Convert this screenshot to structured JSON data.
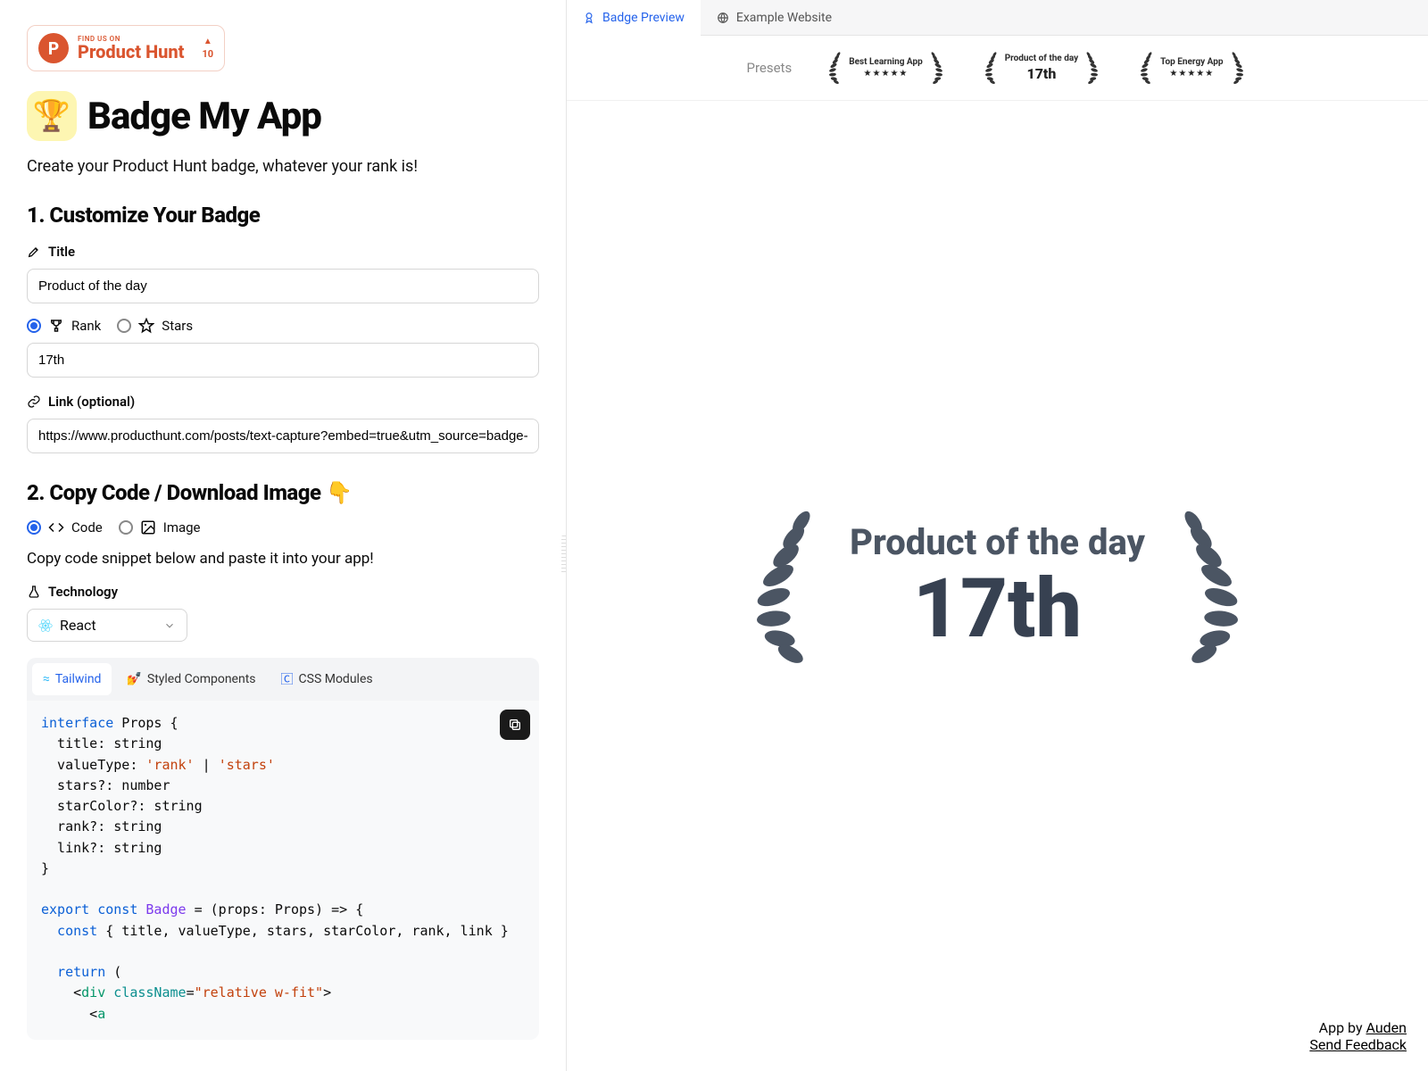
{
  "ph_widget": {
    "find": "FIND US ON",
    "name": "Product Hunt",
    "count": "10"
  },
  "app": {
    "title": "Badge My App",
    "tagline": "Create your Product Hunt badge, whatever your rank is!"
  },
  "section1": {
    "heading": "1. Customize Your Badge",
    "title_label": "Title",
    "title_value": "Product of the day",
    "rank_label": "Rank",
    "stars_label": "Stars",
    "rank_value": "17th",
    "link_label": "Link (optional)",
    "link_value": "https://www.producthunt.com/posts/text-capture?embed=true&utm_source=badge-f"
  },
  "section2": {
    "heading": "2. Copy Code / Download Image 👇",
    "code_label": "Code",
    "image_label": "Image",
    "copy_hint": "Copy code snippet below and paste it into your app!",
    "tech_label": "Technology",
    "tech_value": "React",
    "tabs": {
      "tailwind": "Tailwind",
      "styled": "Styled Components",
      "css": "CSS Modules"
    }
  },
  "code_snippet": {
    "l1a": "interface",
    "l1b": " Props {",
    "l2": "  title: string",
    "l3a": "  valueType: ",
    "l3b": "'rank'",
    "l3c": " | ",
    "l3d": "'stars'",
    "l4": "  stars?: number",
    "l5": "  starColor?: string",
    "l6": "  rank?: string",
    "l7": "  link?: string",
    "l8": "}",
    "l10a": "export",
    "l10b": " const",
    "l10c": " Badge",
    "l10d": " = (props: Props) => {",
    "l11a": "  const",
    "l11b": " { title, valueType, stars, starColor, rank, link }",
    "l13a": "  return",
    "l13b": " (",
    "l14a": "    <",
    "l14b": "div",
    "l14c": " className",
    "l14d": "=",
    "l14e": "\"relative w-fit\"",
    "l14f": ">",
    "l15a": "      <",
    "l15b": "a"
  },
  "preview_tabs": {
    "badge": "Badge Preview",
    "example": "Example Website"
  },
  "presets": {
    "label": "Presets",
    "items": [
      {
        "title": "Best Learning App",
        "type": "stars"
      },
      {
        "title": "Product of the day",
        "type": "rank",
        "rank": "17th"
      },
      {
        "title": "Top Energy App",
        "type": "stars"
      }
    ]
  },
  "big_badge": {
    "title": "Product of the day",
    "rank": "17th"
  },
  "footer": {
    "by_prefix": "App by ",
    "by": "Auden",
    "feedback": "Send Feedback"
  }
}
